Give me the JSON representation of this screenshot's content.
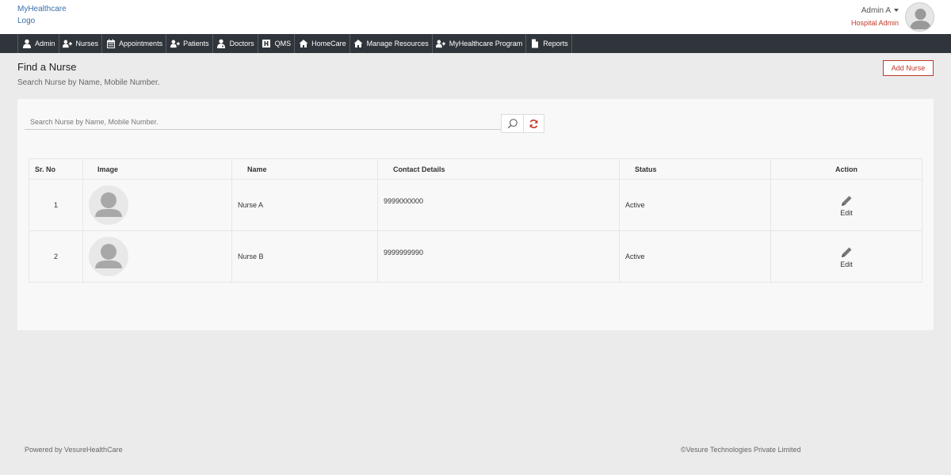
{
  "brand": {
    "line1": "MyHealthcare",
    "line2": "Logo"
  },
  "user": {
    "name": "Admin A",
    "role": "Hospital Admin"
  },
  "nav": [
    {
      "label": "Admin",
      "icon": "user-icon"
    },
    {
      "label": "Nurses",
      "icon": "user-plus-icon"
    },
    {
      "label": "Appointments",
      "icon": "calendar-icon"
    },
    {
      "label": "Patients",
      "icon": "user-plus-icon"
    },
    {
      "label": "Doctors",
      "icon": "doctor-icon"
    },
    {
      "label": "QMS",
      "icon": "hospital-icon"
    },
    {
      "label": "HomeCare",
      "icon": "home-icon"
    },
    {
      "label": "Manage Resources",
      "icon": "home-icon"
    },
    {
      "label": "MyHealthcare Program",
      "icon": "user-plus-icon"
    },
    {
      "label": "Reports",
      "icon": "file-icon"
    }
  ],
  "page": {
    "title": "Find a Nurse",
    "subtitle": "Search Nurse by Name, Mobile Number.",
    "add_label": "Add Nurse"
  },
  "search": {
    "placeholder": "Search Nurse by Name, Mobile Number.",
    "value": ""
  },
  "table": {
    "headers": [
      "Sr. No",
      "Image",
      "Name",
      "Contact Details",
      "Status",
      "Action"
    ],
    "rows": [
      {
        "srno": "1",
        "name": "Nurse A",
        "contact": "9999000000",
        "status": "Active",
        "action": "Edit"
      },
      {
        "srno": "2",
        "name": "Nurse B",
        "contact": "9999999990",
        "status": "Active",
        "action": "Edit"
      }
    ]
  },
  "footer": {
    "left": "Powered by VesureHealthCare",
    "right": "©Vesure Technologies Private Limited"
  },
  "colors": {
    "accent": "#c0392b",
    "navbar": "#2f353b",
    "link": "#3b6fa8"
  }
}
